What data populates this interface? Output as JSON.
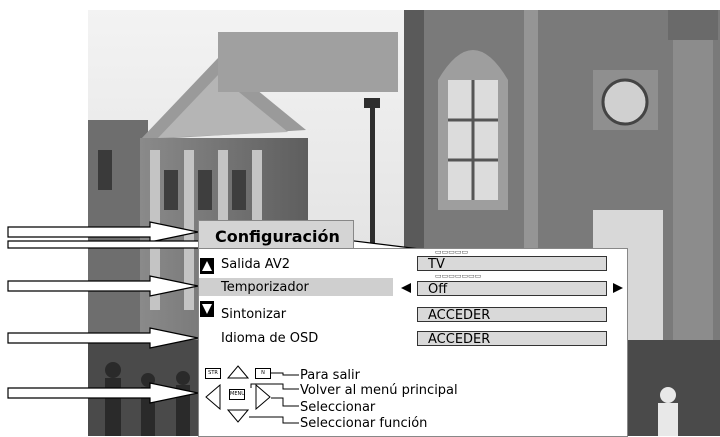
{
  "menu": {
    "title": "Configuración",
    "items": [
      {
        "label": "Salida AV2",
        "value": "TV",
        "selected": false
      },
      {
        "label": "Temporizador",
        "value": "Off",
        "selected": true
      },
      {
        "label": "Sintonizar",
        "value": "ACCEDER",
        "selected": false
      },
      {
        "label": "Idioma de OSD",
        "value": "ACCEDER",
        "selected": false
      }
    ]
  },
  "help": {
    "exit": "Para salir",
    "back": "Volver al menú principal",
    "select": "Seleccionar",
    "select_function": "Seleccionar función",
    "key_str": "STR",
    "key_n": "N",
    "key_menu": "MENU"
  },
  "colors": {
    "panel": "#ffffff",
    "value_box": "#d9d9d9",
    "highlight": "#cfcfcf",
    "title_tab": "#d4d4d4"
  },
  "icons": [
    "up-arrow-icon",
    "down-arrow-icon",
    "left-arrow-icon",
    "right-arrow-icon",
    "callout-arrow-icon"
  ]
}
